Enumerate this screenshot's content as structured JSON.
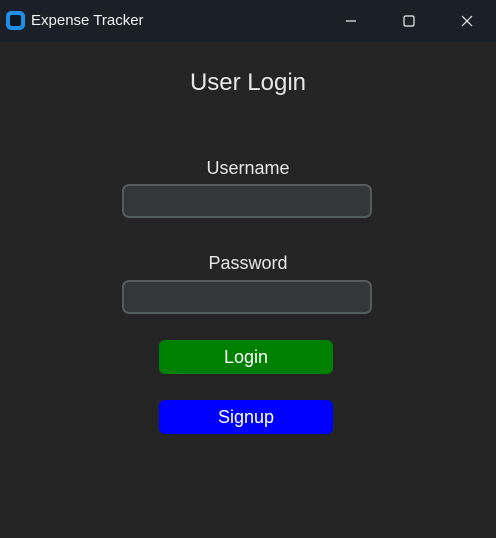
{
  "window": {
    "title": "Expense Tracker",
    "app_icon": "app-icon",
    "controls": {
      "minimize_icon": "minimize-icon",
      "maximize_icon": "maximize-icon",
      "close_icon": "close-icon"
    }
  },
  "form": {
    "heading": "User Login",
    "username": {
      "label": "Username",
      "value": "",
      "placeholder": ""
    },
    "password": {
      "label": "Password",
      "value": "",
      "placeholder": ""
    },
    "login_label": "Login",
    "signup_label": "Signup"
  },
  "colors": {
    "background": "#242424",
    "titlebar": "#1b1f27",
    "login_button": "#008000",
    "signup_button": "#0000ff",
    "input_bg": "#343638",
    "input_border": "#565b5e"
  }
}
